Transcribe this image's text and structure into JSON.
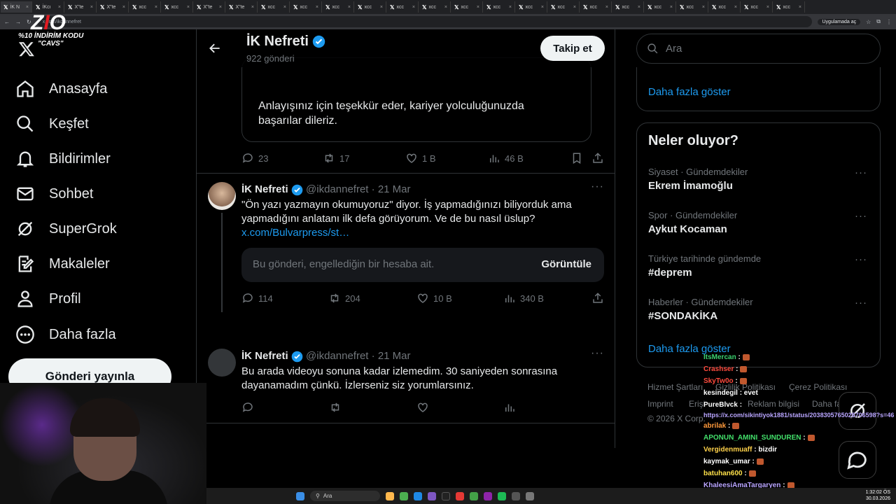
{
  "browser": {
    "tabs": [
      "İK N",
      "İKcı",
      "X\"te",
      "X\"te",
      "xcc",
      "xcc",
      "X\"te",
      "X\"te",
      "xcc",
      "xcc",
      "xcc",
      "xcc",
      "xcc",
      "xcc",
      "xcc",
      "xcc",
      "xcc",
      "xcc",
      "xcc",
      "xcc",
      "xcc",
      "xcc",
      "xcc",
      "xcc",
      "xcc"
    ],
    "url": "x.com/ikdannefret",
    "open_in_app": "Uygulamada aç"
  },
  "overlay_logo": {
    "brand": "ZIO",
    "line1": "%10 İNDİRİM KODU",
    "line2": "\"CAVS\""
  },
  "nav": {
    "items": [
      {
        "label": "Anasayfa",
        "icon": "home-icon"
      },
      {
        "label": "Keşfet",
        "icon": "search-icon"
      },
      {
        "label": "Bildirimler",
        "icon": "bell-icon"
      },
      {
        "label": "Sohbet",
        "icon": "mail-icon"
      },
      {
        "label": "SuperGrok",
        "icon": "grok-icon"
      },
      {
        "label": "Makaleler",
        "icon": "article-icon"
      },
      {
        "label": "Profil",
        "icon": "person-icon"
      },
      {
        "label": "Daha fazla",
        "icon": "more-circle-icon"
      }
    ],
    "post_button": "Gönderi yayınla"
  },
  "header": {
    "name": "İK Nefreti",
    "post_count": "922 gönderi",
    "follow_button": "Takip et"
  },
  "tweets": [
    {
      "quote_text": "Anlayışınız için teşekkür eder, kariyer yolculuğunuzda başarılar dileriz.",
      "replies": "23",
      "reposts": "17",
      "likes": "1 B",
      "views": "46 B"
    },
    {
      "name": "İK Nefreti",
      "handle": "@ikdannefret",
      "date": "· 21 Mar",
      "text": "\"Ön yazı yazmayın okumuyoruz\" diyor. İş yapmadığınızı biliyorduk ama yapmadığını anlatanı ilk defa görüyorum. Ve de bu nasıl üslup?",
      "link": "x.com/Bulvarpress/st…",
      "blocked_text": "Bu gönderi, engellediğin bir hesaba ait.",
      "blocked_button": "Görüntüle",
      "replies": "114",
      "reposts": "204",
      "likes": "10 B",
      "views": "340 B"
    },
    {
      "name": "İK Nefreti",
      "handle": "@ikdannefret",
      "date": "· 21 Mar",
      "text": "Bu arada videoyu sonuna kadar izlemedim. 30 saniyeden sonrasına dayanamadım çünkü. İzlerseniz siz yorumlarsınız."
    }
  ],
  "right": {
    "search_placeholder": "Ara",
    "show_more_top": "Daha fazla göster",
    "trends_title": "Neler oluyor?",
    "trends": [
      {
        "category": "Siyaset · Gündemdekiler",
        "name": "Ekrem İmamoğlu"
      },
      {
        "category": "Spor · Gündemdekiler",
        "name": "Aykut Kocaman"
      },
      {
        "category": "Türkiye tarihinde gündemde",
        "name": "#deprem"
      },
      {
        "category": "Haberler · Gündemdekiler",
        "name": "#SONDAKİKA"
      }
    ],
    "show_more_trends": "Daha fazla göster",
    "footer": [
      "Hizmet Şartları",
      "Gizlilik Politikası",
      "Çerez Politikası",
      "Imprint",
      "Erişi",
      "Reklam bilgisi",
      "Daha fa",
      "© 2026 X Corp."
    ]
  },
  "chat": [
    {
      "user": "ItsMercan",
      "color": "#3bd16f",
      "msg": ":",
      "emote": true
    },
    {
      "user": "Crashser",
      "color": "#ff4b3e",
      "msg": ":",
      "emote": true
    },
    {
      "user": "SkyTw0o",
      "color": "#ff4b3e",
      "msg": ":",
      "emote": true
    },
    {
      "user": "kesindegil",
      "color": "#ffffff",
      "msg": ": evet",
      "emote": false
    },
    {
      "user": "PureBlvck",
      "color": "#ffffff",
      "msg": ":",
      "emote": false
    },
    {
      "user": "abrilak",
      "color": "#ff9a3c",
      "msg": ":",
      "emote": true
    },
    {
      "user": "APONUN_AMINI_SUNDUREN",
      "color": "#43e06b",
      "msg": ":",
      "emote": true
    },
    {
      "user": "Vergidenmuaff",
      "color": "#ffd24a",
      "msg": ": bizdir",
      "emote": false
    },
    {
      "user": "kaymak_umar",
      "color": "#ffffff",
      "msg": ":",
      "emote": true
    },
    {
      "user": "batuhan600",
      "color": "#ffe14a",
      "msg": ":",
      "emote": true
    },
    {
      "user": "KhaleesiAmaTargaryen",
      "color": "#b9a5ff",
      "msg": ":",
      "emote": true
    }
  ],
  "chat_link": "https://x.com/sikintiyok1881/status/2038305765028706598?s=46",
  "taskbar": {
    "search": "Ara",
    "time": "1:32:02 ÖS",
    "date": "30.03.2026"
  },
  "colors": {
    "accent": "#1d9bf0",
    "background": "#000000",
    "muted": "#71767b",
    "border": "#2f3336"
  }
}
